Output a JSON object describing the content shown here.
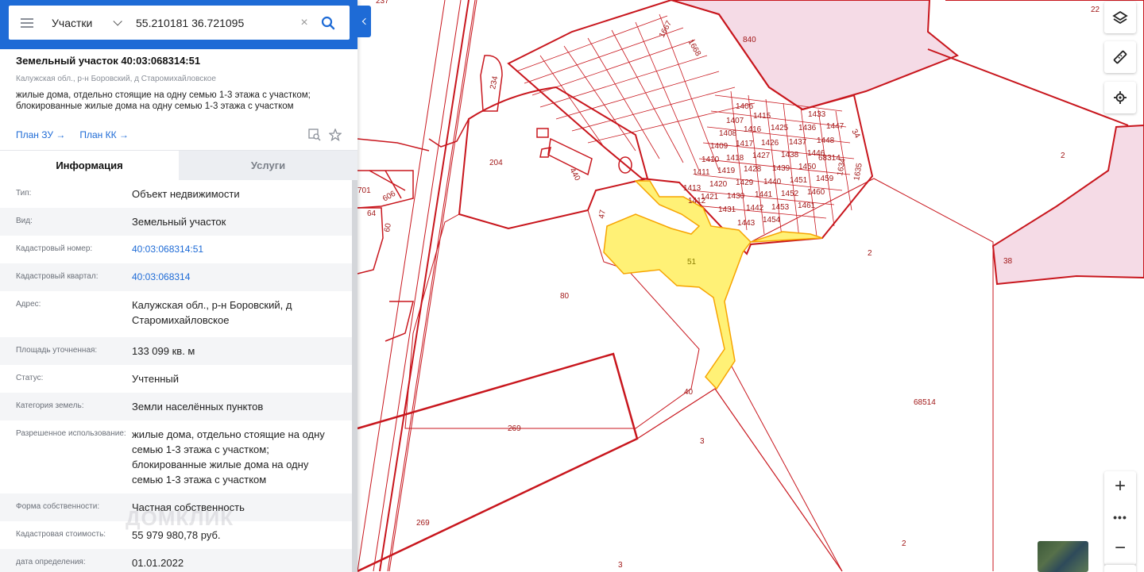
{
  "search": {
    "layer_label": "Участки",
    "query": "55.210181 36.721095",
    "clear_symbol": "×"
  },
  "object": {
    "title": "Земельный участок 40:03:068314:51",
    "address": "Калужская обл., р-н Боровский, д Старомихайловское",
    "usage": "жилые дома, отдельно стоящие на одну семью 1-3 этажа с участком; блокированные жилые дома на одну семью 1-3 этажа с участком",
    "plan_zu": "План ЗУ →",
    "plan_kk": "План КК →"
  },
  "tabs": [
    {
      "label": "Информация",
      "active": true
    },
    {
      "label": "Услуги",
      "active": false
    }
  ],
  "info": [
    {
      "key": "Тип:",
      "value": "Объект недвижимости"
    },
    {
      "key": "Вид:",
      "value": "Земельный участок"
    },
    {
      "key": "Кадастровый номер:",
      "value": "40:03:068314:51"
    },
    {
      "key": "Кадастровый квартал:",
      "value": "40:03:068314"
    },
    {
      "key": "Адрес:",
      "value": "Калужская обл., р-н Боровский, д Старомихайловское"
    },
    {
      "key": "Площадь уточненная:",
      "value": "133 099 кв. м"
    },
    {
      "key": "Статус:",
      "value": "Учтенный"
    },
    {
      "key": "Категория земель:",
      "value": "Земли населённых пунктов"
    },
    {
      "key": "Разрешенное использование:",
      "value": "жилые дома, отдельно стоящие на одну семью 1-3 этажа с участком; блокированные жилые дома на одну семью 1-3 этажа с участком"
    },
    {
      "key": "Форма собственности:",
      "value": "Частная собственность"
    },
    {
      "key": "Кадастровая стоимость:",
      "value": "55 979 980,78 руб."
    },
    {
      "key": "дата определения:",
      "value": "01.01.2022"
    }
  ],
  "watermark": "ДОМКЛИК",
  "controls": {
    "zoom_in": "+",
    "more": "•••",
    "zoom_out": "−"
  },
  "colors": {
    "accent": "#1e6bd6",
    "parcel_line": "#c8161d",
    "selected_fill": "#fff176",
    "pink_zone": "#f5dbe6"
  },
  "map_labels": {
    "n237": "237",
    "n22": "22",
    "n840": "840",
    "n1667": "1667",
    "n1668": "1668",
    "n234": "234",
    "n204": "204",
    "n440": "440",
    "n47": "47",
    "n51": "51",
    "n80": "80",
    "n40": "40",
    "n269a": "269",
    "n269b": "269",
    "n3a": "3",
    "n3b": "3",
    "n2a": "2",
    "n2b": "2",
    "n2c": "2",
    "n38": "38",
    "n68514": "68514",
    "n68314": "68314",
    "n34": "34",
    "n1634": "1634",
    "n1635": "1635",
    "n60": "60",
    "n64": "64",
    "n606": "606",
    "n701": "701",
    "n1406": "1406",
    "n1415": "1415",
    "n1407": "1407",
    "n1416": "1416",
    "n1425": "1425",
    "n1408": "1408",
    "n1417": "1417",
    "n1426": "1426",
    "n1437": "1437",
    "n1436": "1436",
    "n1433": "1433",
    "n1447": "1447",
    "n1448": "1448",
    "n1409": "1409",
    "n1418": "1418",
    "n1427": "1427",
    "n1438": "1438",
    "n1446": "1446",
    "n1410": "1410",
    "n1419": "1419",
    "n1428": "1428",
    "n1439": "1439",
    "n1450": "1450",
    "n1411": "1411",
    "n1420": "1420",
    "n1429": "1429",
    "n1440": "1440",
    "n1451": "1451",
    "n1459": "1459",
    "n1413": "1413",
    "n1421": "1421",
    "n1430": "1430",
    "n1441": "1441",
    "n1452": "1452",
    "n1460": "1460",
    "n1412": "1412",
    "n1431": "1431",
    "n1442": "1442",
    "n1453": "1453",
    "n1461": "1461",
    "n1443": "1443",
    "n1454": "1454"
  }
}
